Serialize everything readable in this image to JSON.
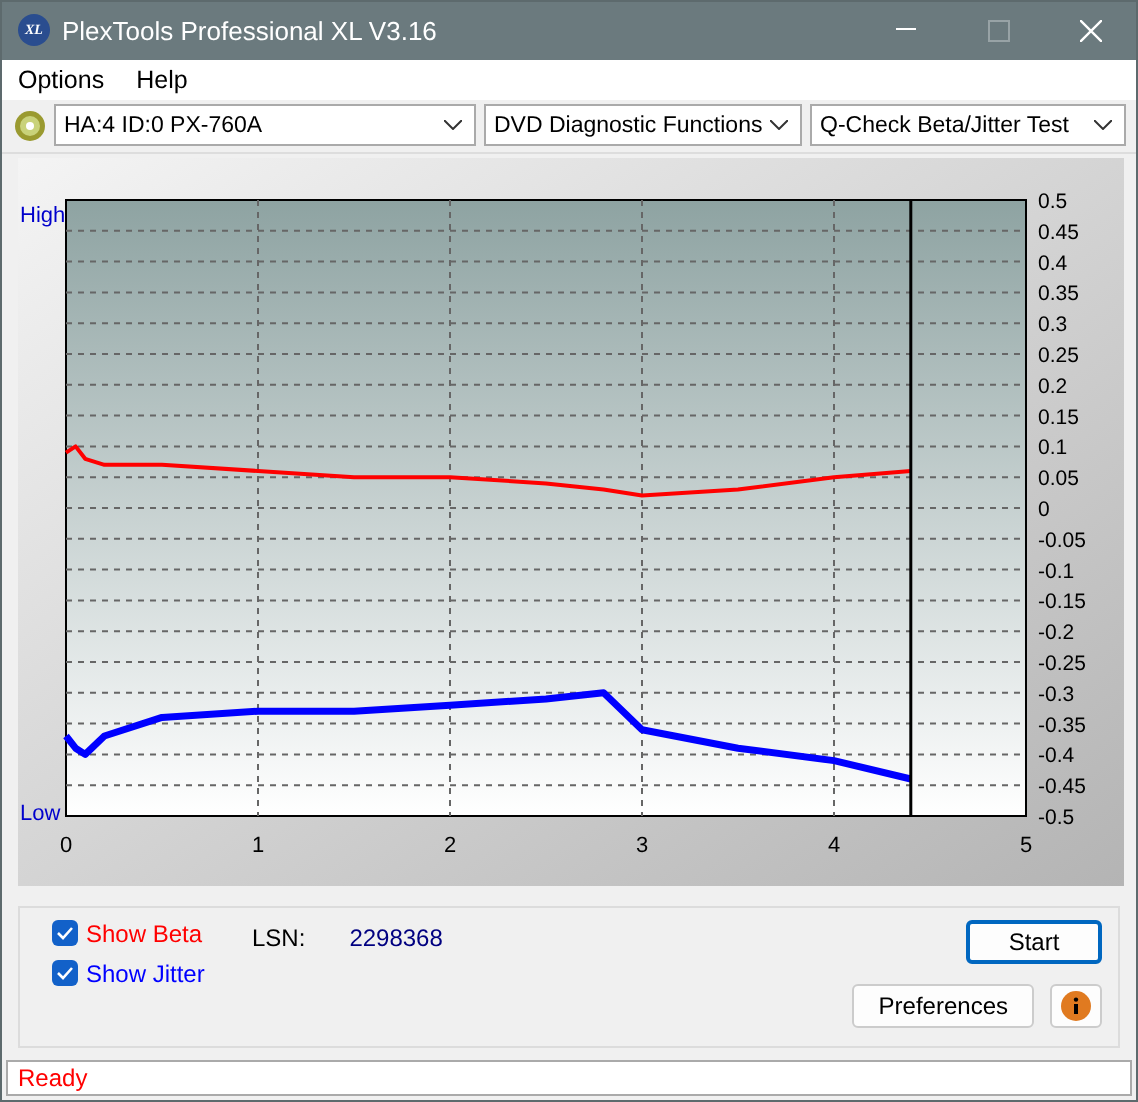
{
  "window": {
    "title": "PlexTools Professional XL V3.16",
    "logo": "XL"
  },
  "menu": [
    {
      "label": "Options"
    },
    {
      "label": "Help"
    }
  ],
  "toolbar": {
    "drive": "HA:4 ID:0  PX-760A",
    "category": "DVD Diagnostic Functions",
    "test": "Q-Check Beta/Jitter Test"
  },
  "chart": {
    "high_label": "High",
    "low_label": "Low",
    "chart_data": {
      "type": "line",
      "x": [
        0,
        0.05,
        0.1,
        0.2,
        0.5,
        1,
        1.5,
        2,
        2.5,
        2.8,
        3,
        3.5,
        4,
        4.4
      ],
      "series": [
        {
          "color": "#ff0000",
          "values": [
            0.09,
            0.1,
            0.08,
            0.07,
            0.07,
            0.06,
            0.05,
            0.05,
            0.04,
            0.03,
            0.02,
            0.03,
            0.05,
            0.06
          ]
        },
        {
          "color": "#0000ff",
          "values": [
            -0.37,
            -0.39,
            -0.4,
            -0.37,
            -0.34,
            -0.33,
            -0.33,
            -0.32,
            -0.31,
            -0.3,
            -0.36,
            -0.39,
            -0.41,
            -0.44
          ]
        }
      ],
      "grid": true,
      "ref_lines": [
        {
          "axis": "x",
          "value": 4.4,
          "color": "#000000"
        }
      ],
      "xlim": [
        0,
        5
      ],
      "ylim": [
        -0.5,
        0.5
      ],
      "xticks": [
        0,
        1,
        2,
        3,
        4,
        5
      ],
      "yticks": [
        0.5,
        0.45,
        0.4,
        0.35,
        0.3,
        0.25,
        0.2,
        0.15,
        0.1,
        0.05,
        0,
        -0.05,
        -0.1,
        -0.15,
        -0.2,
        -0.25,
        -0.3,
        -0.35,
        -0.4,
        -0.45,
        -0.5
      ]
    }
  },
  "controls": {
    "options": [
      {
        "label": "Show Beta",
        "checked": true,
        "color": "#ff0000"
      },
      {
        "label": "Show Jitter",
        "checked": true,
        "color": "#0000ff"
      }
    ],
    "lsn_label": "LSN:",
    "lsn_value": "2298368",
    "buttons": [
      "Start",
      "Preferences"
    ]
  },
  "status_bar": "Ready"
}
